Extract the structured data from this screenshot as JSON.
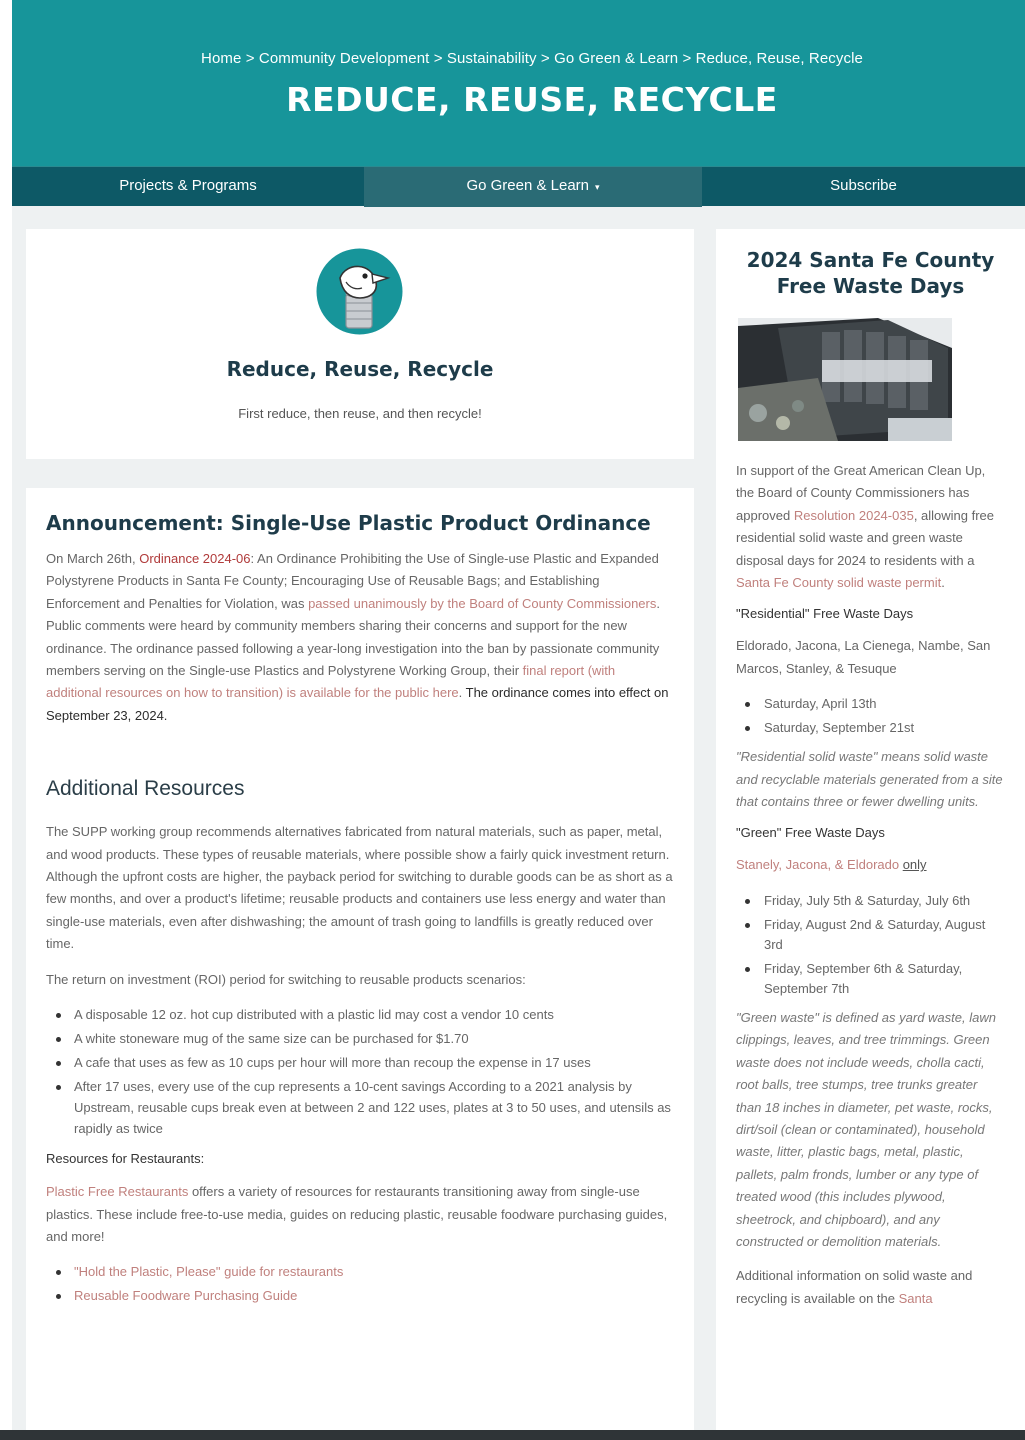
{
  "breadcrumb": {
    "items": [
      "Home",
      "Community Development",
      "Sustainability",
      "Go Green & Learn",
      "Reduce, Reuse, Recycle"
    ],
    "separator": ">"
  },
  "hero": {
    "title": "REDUCE, REUSE, RECYCLE"
  },
  "nav": {
    "items": [
      {
        "label": "Projects & Programs"
      },
      {
        "label": "Go Green & Learn",
        "caret": "▾"
      },
      {
        "label": "Subscribe"
      }
    ]
  },
  "intro": {
    "logo_icon": "recycle-bird-can-icon",
    "title": "Reduce, Reuse, Recycle",
    "subtitle": "First reduce, then reuse, and then recycle!"
  },
  "announcement": {
    "title": "Announcement: Single-Use Plastic Product Ordinance",
    "p_prefix": "On March 26th, ",
    "ordinance_link": "Ordinance 2024-06",
    "p_part2": ": An Ordinance Prohibiting the Use of Single-use Plastic and Expanded Polystyrene Products in Santa Fe County; Encouraging Use of Reusable Bags; and Establishing Enforcement and Penalties for Violation, was ",
    "passed_link": "passed unanimously by the Board of County Commissioners",
    "p_part3": ". Public comments were heard by community members sharing their concerns and support for the new ordinance. The ordinance passed following a year-long investigation into the ban by passionate community members serving on the Single-use Plastics and Polystyrene Working Group, their ",
    "report_link": "final report (with additional resources on how to transition) is available for the public here",
    "p_part4": ". ",
    "effective": "The ordinance comes into effect on September 23, 2024."
  },
  "resources": {
    "title": "Additional Resources",
    "para1": "The SUPP working group recommends alternatives fabricated from natural materials, such as paper, metal, and wood products.  These types of reusable materials, where possible show a fairly quick investment return.  Although the upfront costs are higher, the payback period for switching to durable goods can be as short as a few months, and over a product's lifetime; reusable products and containers use less energy and water than single-use materials, even after dishwashing; the amount of trash going to landfills is greatly reduced over time.",
    "para2": "The return on investment (ROI) period for switching to reusable products scenarios:",
    "bullets": [
      "A disposable 12 oz. hot cup distributed with a plastic lid may cost a vendor 10 cents",
      "A white stoneware mug of the same size can be purchased for $1.70",
      "A cafe that uses as few as 10 cups per hour will more than recoup the expense in 17 uses",
      "After 17 uses, every use of the cup represents a 10-cent savings According to a 2021 analysis by Upstream, reusable cups break even at between 2 and 122 uses, plates at 3 to 50 uses, and utensils as rapidly as twice"
    ],
    "restaurants_heading": "Resources for Restaurants:",
    "restaurants_link": "Plastic Free Restaurants",
    "restaurants_text": " offers a variety of resources for restaurants transitioning away from single-use plastics. These include free-to-use media, guides on reducing plastic, reusable foodware purchasing guides, and more!",
    "restaurant_links": [
      "\"Hold the Plastic, Please\" guide for restaurants",
      "Reusable Foodware Purchasing Guide"
    ]
  },
  "sidebar": {
    "title": "2024 Santa Fe County Free Waste Days",
    "image_icon": "waste-container-photo",
    "intro_part1": "In support of the Great American Clean Up, the Board of County Commissioners has approved ",
    "resolution_link": "Resolution 2024-035",
    "intro_part2": ", allowing free residential solid waste and green waste disposal days for 2024 to residents with a ",
    "permit_link": "Santa Fe County solid waste permit",
    "intro_part3": ".",
    "residential_heading": "\"Residential\" Free Waste Days",
    "residential_locations": "Eldorado, Jacona, La Cienega, Nambe, San Marcos, Stanley, & Tesuque",
    "residential_dates": [
      "Saturday, April 13th",
      "Saturday, September 21st"
    ],
    "residential_def": "\"Residential solid waste\" means solid waste and recyclable materials generated from a site that contains three or fewer dwelling units.",
    "green_heading": "\"Green\" Free Waste Days",
    "green_locations": "Stanely, Jacona, & Eldorado ",
    "green_only": "only",
    "green_dates": [
      "Friday, July 5th & Saturday, July 6th",
      "Friday, August 2nd & Saturday, August 3rd",
      "Friday, September 6th & Saturday, September 7th"
    ],
    "green_def": "\"Green waste\" is defined as yard waste, lawn clippings, leaves, and tree trimmings. Green waste does not include weeds, cholla cacti, root balls, tree stumps, tree trunks greater than 18 inches in diameter, pet waste, rocks, dirt/soil (clean or contaminated), household waste, litter, plastic bags, metal, plastic, pallets, palm fronds, lumber or any type of treated wood (this includes plywood, sheetrock, and chipboard), and any constructed or demolition materials.",
    "additional_part1": "Additional information on solid waste and recycling is available on the ",
    "additional_link": "Santa"
  },
  "colors": {
    "hero": "#17959a",
    "nav": "#0d5966",
    "nav_active": "#2a6b75",
    "heading": "#1e3c4a",
    "link": "#c0807d",
    "ordinance_link": "#b03a3a"
  }
}
